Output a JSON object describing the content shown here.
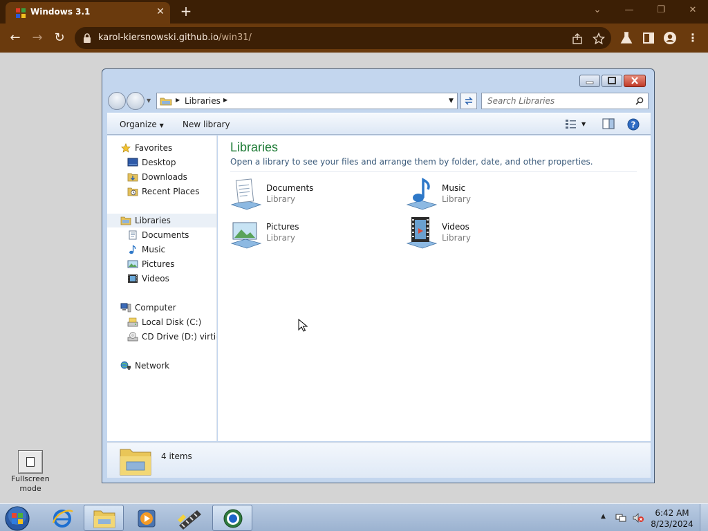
{
  "browser": {
    "tab_title": "Windows 3.1",
    "url_host": "karol-kiersnowski.github.io",
    "url_path": "/win31/"
  },
  "desktop": {
    "fullscreen_label": "Fullscreen mode"
  },
  "explorer": {
    "breadcrumb": "Libraries",
    "search_placeholder": "Search Libraries",
    "toolbar": {
      "organize": "Organize",
      "new_library": "New library"
    },
    "nav": {
      "favorites": "Favorites",
      "desktop": "Desktop",
      "downloads": "Downloads",
      "recent_places": "Recent Places",
      "libraries": "Libraries",
      "documents": "Documents",
      "music": "Music",
      "pictures": "Pictures",
      "videos": "Videos",
      "computer": "Computer",
      "local_disk": "Local Disk (C:)",
      "cd_drive": "CD Drive (D:) virtio-w",
      "network": "Network"
    },
    "content": {
      "title": "Libraries",
      "subtitle": "Open a library to see your files and arrange them by folder, date, and other properties.",
      "libraries": [
        {
          "name": "Documents",
          "type": "Library"
        },
        {
          "name": "Music",
          "type": "Library"
        },
        {
          "name": "Pictures",
          "type": "Library"
        },
        {
          "name": "Videos",
          "type": "Library"
        }
      ]
    },
    "details": {
      "count": "4 items"
    }
  },
  "taskbar": {
    "time": "6:42 AM",
    "date": "8/23/2024"
  },
  "colors": {
    "chrome_tab_strip": "#3c1f05",
    "chrome_toolbar": "#6a3a0d",
    "library_title": "#1e7b36"
  }
}
